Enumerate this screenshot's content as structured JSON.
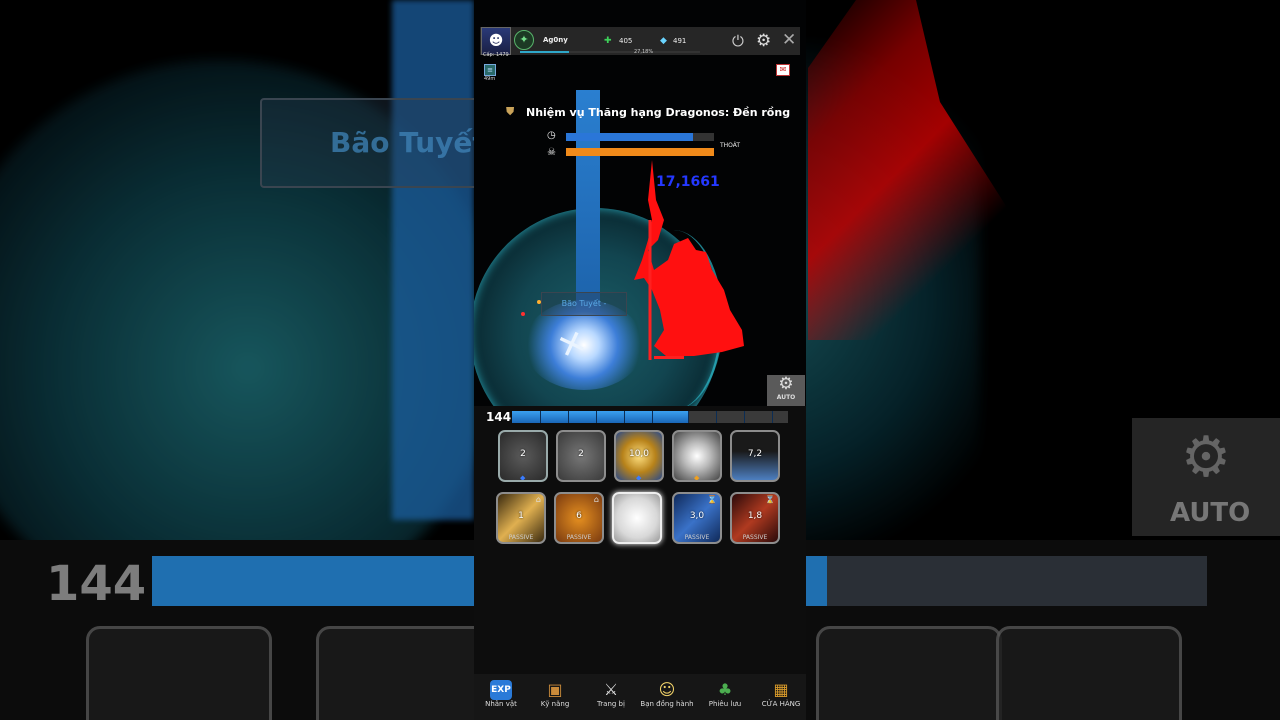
{
  "player": {
    "name": "Ag0ny",
    "level_label": "Cấp: 1479",
    "exp_percent": "27,18%",
    "exp_fraction": 0.2718,
    "avatar_icon": "player-avatar"
  },
  "currency": {
    "gems": "405",
    "diamonds": "491"
  },
  "buff": {
    "timer": "49m"
  },
  "quest": {
    "title": "Nhiệm vụ Thăng hạng Dragonos: Đền rồng",
    "time_fraction": 0.86,
    "boss_hp_fraction": 1.0,
    "exit_label": "THOÁT"
  },
  "battle": {
    "skill_label": "Bão Tuyết -",
    "damage": "17,1661"
  },
  "auto_label": "AUTO",
  "mana": {
    "level": "144",
    "fraction": 0.64
  },
  "skills_row1": [
    {
      "cooldown": "2"
    },
    {
      "cooldown": "2"
    },
    {
      "cooldown": "10,0"
    },
    {
      "cooldown": ""
    },
    {
      "cooldown": "7,2"
    }
  ],
  "skills_row2": [
    {
      "cooldown": "1",
      "label": "PASSIVE"
    },
    {
      "cooldown": "6",
      "label": "PASSIVE"
    },
    {
      "cooldown": "",
      "label": ""
    },
    {
      "cooldown": "3,0",
      "label": "PASSIVE"
    },
    {
      "cooldown": "1,8",
      "label": "PASSIVE"
    }
  ],
  "nav": [
    {
      "label": "Nhân vật",
      "icon": "exp-icon"
    },
    {
      "label": "Kỹ năng",
      "icon": "skill-book-icon"
    },
    {
      "label": "Trang bị",
      "icon": "crossed-swords-icon"
    },
    {
      "label": "Bạn đồng hành",
      "icon": "companion-icon"
    },
    {
      "label": "Phiêu lưu",
      "icon": "tree-icon"
    },
    {
      "label": "CỬA HÀNG",
      "icon": "shop-chest-icon"
    }
  ],
  "colors": {
    "mana_blue": "#2a7fd8",
    "boss_red": "#ff1010",
    "boss_bar_orange": "#f08a1a",
    "damage_blue": "#2438ff"
  }
}
